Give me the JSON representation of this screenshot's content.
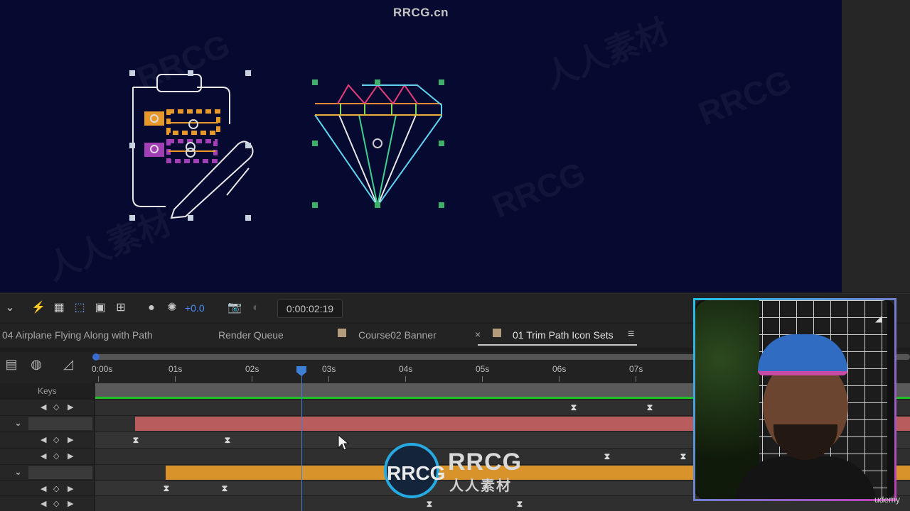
{
  "watermark": {
    "top": "RRCG.cn",
    "ghost_text": "RRCG",
    "ghost_cn": "人人素材"
  },
  "toolbar": {
    "exposure": "+0.0",
    "timecode": "0:00:02:19"
  },
  "tabs": [
    {
      "label": "04 Airplane Flying Along with Path"
    },
    {
      "label": "Render Queue"
    },
    {
      "label": "Course02 Banner"
    },
    {
      "label": "01 Trim Path Icon Sets",
      "active": true
    }
  ],
  "ruler": {
    "ticks": [
      "0:00s",
      "01s",
      "02s",
      "03s",
      "04s",
      "05s",
      "06s",
      "07s"
    ]
  },
  "timeline": {
    "keys_label": "Keys",
    "layer_colors": {
      "pink": "#b85c5e",
      "orange": "#d9932b"
    },
    "playhead_color": "#3f7fd6"
  },
  "footer": {
    "logo": "RRCG",
    "logo_sub": "人人素材",
    "brand": "udemy"
  },
  "colors": {
    "viewer_bg": "#060930",
    "accent": "#4a8dff"
  }
}
